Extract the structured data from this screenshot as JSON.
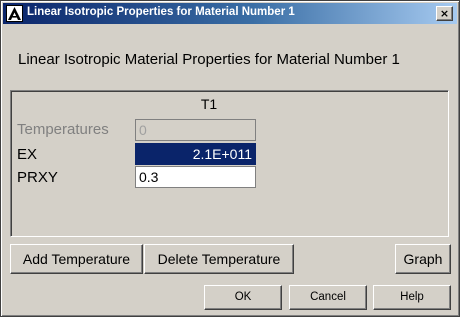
{
  "window": {
    "title": "Linear Isotropic Properties for Material Number 1",
    "close_glyph": "×"
  },
  "heading": "Linear Isotropic Material Properties for Material Number 1",
  "table": {
    "column_header": "T1",
    "rows": [
      {
        "label": "Temperatures",
        "value": "0",
        "state": "disabled"
      },
      {
        "label": "EX",
        "value": "2.1E+011",
        "state": "selected"
      },
      {
        "label": "PRXY",
        "value": "0.3",
        "state": "normal"
      }
    ]
  },
  "buttons": {
    "add_temperature": "Add Temperature",
    "delete_temperature": "Delete Temperature",
    "graph": "Graph",
    "ok": "OK",
    "cancel": "Cancel",
    "help": "Help"
  },
  "colors": {
    "title_bar_start": "#0a246a",
    "title_bar_end": "#a6caf0",
    "selection": "#0a246a",
    "face": "#d4d0c8"
  },
  "icons": {
    "app": "ansys-logo-icon",
    "close": "close-icon"
  }
}
